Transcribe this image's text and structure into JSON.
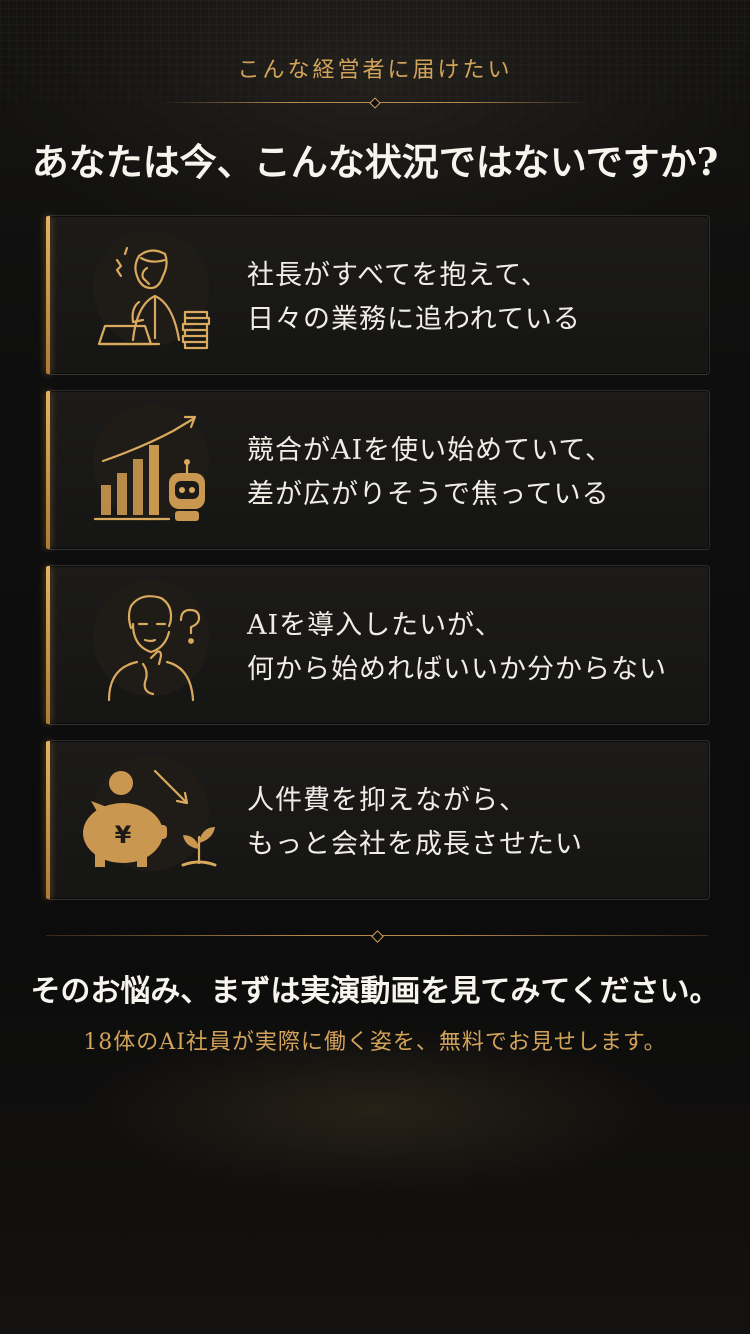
{
  "header": {
    "eyebrow": "こんな経営者に届けたい",
    "headline": "あなたは今、こんな状況ではないですか?"
  },
  "cards": [
    {
      "icon": "overwhelmed-ceo-icon",
      "line1": "社長がすべてを抱えて、",
      "line2": "日々の業務に追われている"
    },
    {
      "icon": "growth-chart-robot-icon",
      "line1": "競合がAIを使い始めていて、",
      "line2": "差が広がりそうで焦っている"
    },
    {
      "icon": "confused-person-icon",
      "line1": "AIを導入したいが、",
      "line2": "何から始めればいいか分からない"
    },
    {
      "icon": "piggy-bank-sprout-icon",
      "line1": "人件費を抑えながら、",
      "line2": "もっと会社を成長させたい"
    }
  ],
  "footer": {
    "cta": "そのお悩み、まずは実演動画を見てみてください。",
    "sub": "18体のAI社員が実際に働く姿を、無料でお見せします。"
  },
  "colors": {
    "accent_gold": "#d3a35a",
    "background": "#0e0e0e",
    "text": "#f2efe8"
  }
}
